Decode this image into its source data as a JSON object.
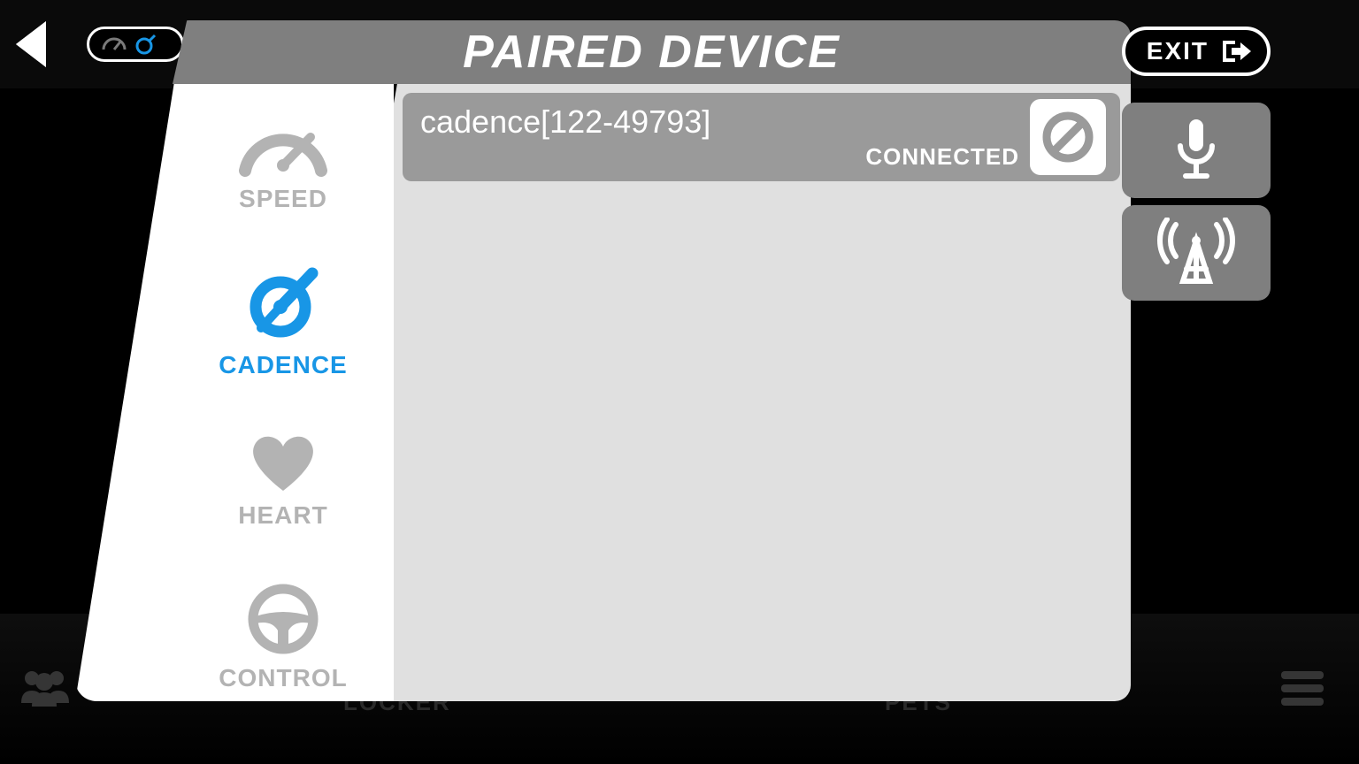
{
  "modal": {
    "title": "PAIRED DEVICE"
  },
  "sidebar": {
    "items": [
      {
        "label": "SPEED"
      },
      {
        "label": "CADENCE"
      },
      {
        "label": "HEART"
      },
      {
        "label": "CONTROL"
      }
    ]
  },
  "devices": [
    {
      "name": "cadence[122-49793]",
      "status": "CONNECTED"
    }
  ],
  "exit_label": "EXIT",
  "bottom_nav": {
    "locker": "LOCKER",
    "pets": "PETS"
  }
}
